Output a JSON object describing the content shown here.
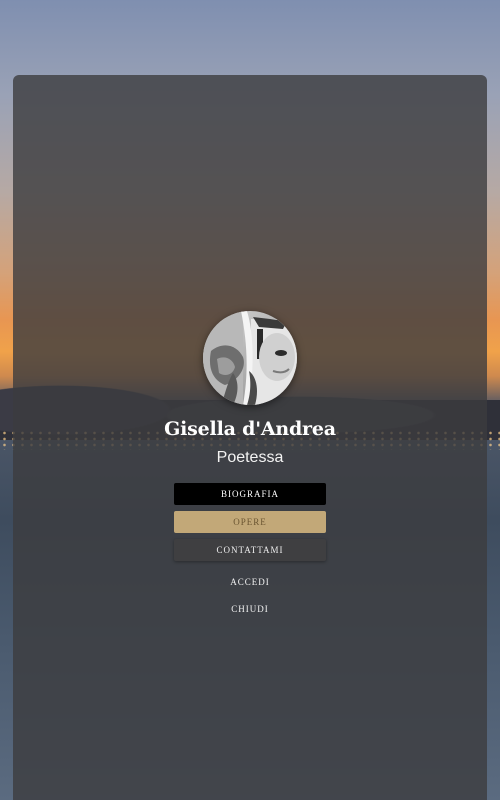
{
  "profile": {
    "name": "Gisella d'Andrea",
    "role": "Poetessa"
  },
  "nav": {
    "biografia": "BIOGRAFIA",
    "opere": "OPERE",
    "contattami": "CONTATTAMI",
    "accedi": "ACCEDI",
    "chiudi": "CHIUDI"
  },
  "colors": {
    "panel": "#3c3c3e",
    "button_biografia": "#000000",
    "button_opere": "#c2a878",
    "button_contattami": "#3f3f41"
  }
}
